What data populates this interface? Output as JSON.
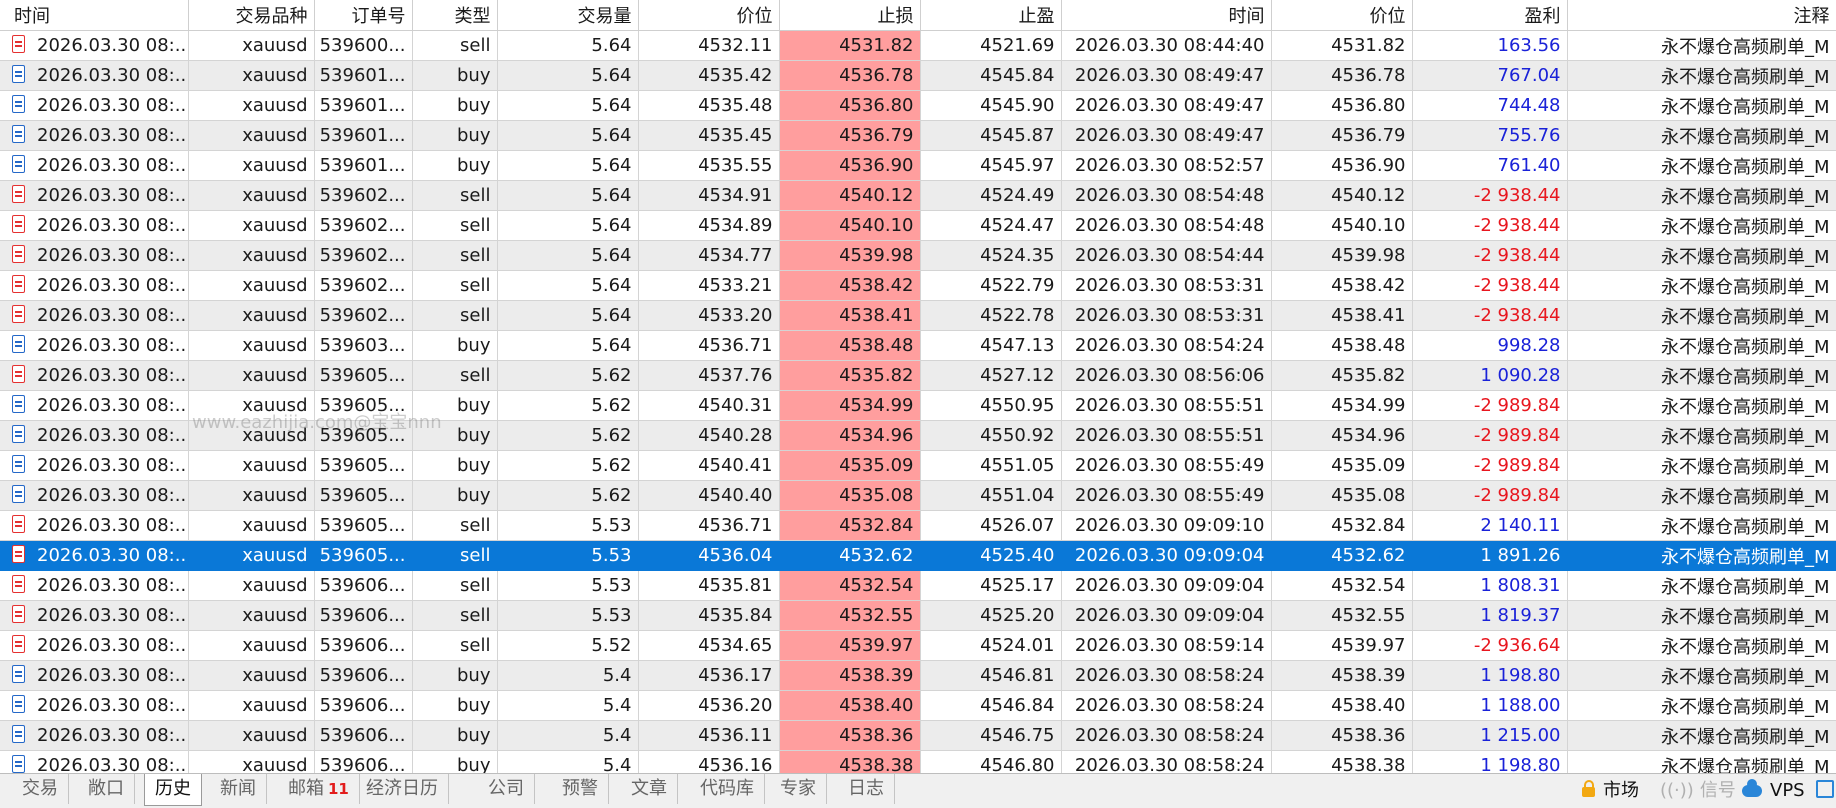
{
  "columns": [
    "时间",
    "交易品种",
    "订单号",
    "类型",
    "交易量",
    "价位",
    "止损",
    "止盈",
    "时间",
    "价位",
    "盈利",
    "注释"
  ],
  "rows": [
    [
      "2026.03.30 08:...",
      "xauusd",
      "539600...",
      "sell",
      "5.64",
      "4532.11",
      "4531.82",
      "4521.69",
      "2026.03.30 08:44:40",
      "4531.82",
      "163.56",
      "永不爆仓高频刷单_M"
    ],
    [
      "2026.03.30 08:...",
      "xauusd",
      "539601...",
      "buy",
      "5.64",
      "4535.42",
      "4536.78",
      "4545.84",
      "2026.03.30 08:49:47",
      "4536.78",
      "767.04",
      "永不爆仓高频刷单_M"
    ],
    [
      "2026.03.30 08:...",
      "xauusd",
      "539601...",
      "buy",
      "5.64",
      "4535.48",
      "4536.80",
      "4545.90",
      "2026.03.30 08:49:47",
      "4536.80",
      "744.48",
      "永不爆仓高频刷单_M"
    ],
    [
      "2026.03.30 08:...",
      "xauusd",
      "539601...",
      "buy",
      "5.64",
      "4535.45",
      "4536.79",
      "4545.87",
      "2026.03.30 08:49:47",
      "4536.79",
      "755.76",
      "永不爆仓高频刷单_M"
    ],
    [
      "2026.03.30 08:...",
      "xauusd",
      "539601...",
      "buy",
      "5.64",
      "4535.55",
      "4536.90",
      "4545.97",
      "2026.03.30 08:52:57",
      "4536.90",
      "761.40",
      "永不爆仓高频刷单_M"
    ],
    [
      "2026.03.30 08:...",
      "xauusd",
      "539602...",
      "sell",
      "5.64",
      "4534.91",
      "4540.12",
      "4524.49",
      "2026.03.30 08:54:48",
      "4540.12",
      "-2 938.44",
      "永不爆仓高频刷单_M"
    ],
    [
      "2026.03.30 08:...",
      "xauusd",
      "539602...",
      "sell",
      "5.64",
      "4534.89",
      "4540.10",
      "4524.47",
      "2026.03.30 08:54:48",
      "4540.10",
      "-2 938.44",
      "永不爆仓高频刷单_M"
    ],
    [
      "2026.03.30 08:...",
      "xauusd",
      "539602...",
      "sell",
      "5.64",
      "4534.77",
      "4539.98",
      "4524.35",
      "2026.03.30 08:54:44",
      "4539.98",
      "-2 938.44",
      "永不爆仓高频刷单_M"
    ],
    [
      "2026.03.30 08:...",
      "xauusd",
      "539602...",
      "sell",
      "5.64",
      "4533.21",
      "4538.42",
      "4522.79",
      "2026.03.30 08:53:31",
      "4538.42",
      "-2 938.44",
      "永不爆仓高频刷单_M"
    ],
    [
      "2026.03.30 08:...",
      "xauusd",
      "539602...",
      "sell",
      "5.64",
      "4533.20",
      "4538.41",
      "4522.78",
      "2026.03.30 08:53:31",
      "4538.41",
      "-2 938.44",
      "永不爆仓高频刷单_M"
    ],
    [
      "2026.03.30 08:...",
      "xauusd",
      "539603...",
      "buy",
      "5.64",
      "4536.71",
      "4538.48",
      "4547.13",
      "2026.03.30 08:54:24",
      "4538.48",
      "998.28",
      "永不爆仓高频刷单_M"
    ],
    [
      "2026.03.30 08:...",
      "xauusd",
      "539605...",
      "sell",
      "5.62",
      "4537.76",
      "4535.82",
      "4527.12",
      "2026.03.30 08:56:06",
      "4535.82",
      "1 090.28",
      "永不爆仓高频刷单_M"
    ],
    [
      "2026.03.30 08:...",
      "xauusd",
      "539605...",
      "buy",
      "5.62",
      "4540.31",
      "4534.99",
      "4550.95",
      "2026.03.30 08:55:51",
      "4534.99",
      "-2 989.84",
      "永不爆仓高频刷单_M"
    ],
    [
      "2026.03.30 08:...",
      "xauusd",
      "539605...",
      "buy",
      "5.62",
      "4540.28",
      "4534.96",
      "4550.92",
      "2026.03.30 08:55:51",
      "4534.96",
      "-2 989.84",
      "永不爆仓高频刷单_M"
    ],
    [
      "2026.03.30 08:...",
      "xauusd",
      "539605...",
      "buy",
      "5.62",
      "4540.41",
      "4535.09",
      "4551.05",
      "2026.03.30 08:55:49",
      "4535.09",
      "-2 989.84",
      "永不爆仓高频刷单_M"
    ],
    [
      "2026.03.30 08:...",
      "xauusd",
      "539605...",
      "buy",
      "5.62",
      "4540.40",
      "4535.08",
      "4551.04",
      "2026.03.30 08:55:49",
      "4535.08",
      "-2 989.84",
      "永不爆仓高频刷单_M"
    ],
    [
      "2026.03.30 08:...",
      "xauusd",
      "539605...",
      "sell",
      "5.53",
      "4536.71",
      "4532.84",
      "4526.07",
      "2026.03.30 09:09:10",
      "4532.84",
      "2 140.11",
      "永不爆仓高频刷单_M"
    ],
    [
      "2026.03.30 08:...",
      "xauusd",
      "539605...",
      "sell",
      "5.53",
      "4536.04",
      "4532.62",
      "4525.40",
      "2026.03.30 09:09:04",
      "4532.62",
      "1 891.26",
      "永不爆仓高频刷单_M"
    ],
    [
      "2026.03.30 08:...",
      "xauusd",
      "539606...",
      "sell",
      "5.53",
      "4535.81",
      "4532.54",
      "4525.17",
      "2026.03.30 09:09:04",
      "4532.54",
      "1 808.31",
      "永不爆仓高频刷单_M"
    ],
    [
      "2026.03.30 08:...",
      "xauusd",
      "539606...",
      "sell",
      "5.53",
      "4535.84",
      "4532.55",
      "4525.20",
      "2026.03.30 09:09:04",
      "4532.55",
      "1 819.37",
      "永不爆仓高频刷单_M"
    ],
    [
      "2026.03.30 08:...",
      "xauusd",
      "539606...",
      "sell",
      "5.52",
      "4534.65",
      "4539.97",
      "4524.01",
      "2026.03.30 08:59:14",
      "4539.97",
      "-2 936.64",
      "永不爆仓高频刷单_M"
    ],
    [
      "2026.03.30 08:...",
      "xauusd",
      "539606...",
      "buy",
      "5.4",
      "4536.17",
      "4538.39",
      "4546.81",
      "2026.03.30 08:58:24",
      "4538.39",
      "1 198.80",
      "永不爆仓高频刷单_M"
    ],
    [
      "2026.03.30 08:...",
      "xauusd",
      "539606...",
      "buy",
      "5.4",
      "4536.20",
      "4538.40",
      "4546.84",
      "2026.03.30 08:58:24",
      "4538.40",
      "1 188.00",
      "永不爆仓高频刷单_M"
    ],
    [
      "2026.03.30 08:...",
      "xauusd",
      "539606...",
      "buy",
      "5.4",
      "4536.11",
      "4538.36",
      "4546.75",
      "2026.03.30 08:58:24",
      "4538.36",
      "1 215.00",
      "永不爆仓高频刷单_M"
    ],
    [
      "2026.03.30 08:...",
      "xauusd",
      "539606...",
      "buy",
      "5.4",
      "4536.16",
      "4538.38",
      "4546.80",
      "2026.03.30 08:58:24",
      "4538.38",
      "1 198.80",
      "永不爆仓高频刷单_M"
    ]
  ],
  "selected_row": 17,
  "watermark": "www.eazhijia.com@宝宝nnn",
  "tabs": [
    "交易",
    "敞口",
    "历史",
    "新闻",
    "邮箱",
    "经济日历",
    "公司",
    "预警",
    "文章",
    "代码库",
    "专家",
    "日志"
  ],
  "active_tab": "历史",
  "mailbox_badge": "11",
  "status": {
    "market": "市场",
    "signals": "信号",
    "vps": "VPS"
  },
  "icons": {
    "sell_row": "sell-order-doc-icon",
    "buy_row": "buy-order-doc-icon",
    "market": "lock-icon",
    "signals": "signal-waves-icon",
    "vps": "cloud-icon",
    "tail": "chip-icon"
  },
  "colors": {
    "stop_loss_bg": "#ff9e9e",
    "selected_bg": "#0a78d7",
    "profit": "#1a22d8",
    "loss": "#e8161e",
    "alt_row": "#ececec"
  }
}
